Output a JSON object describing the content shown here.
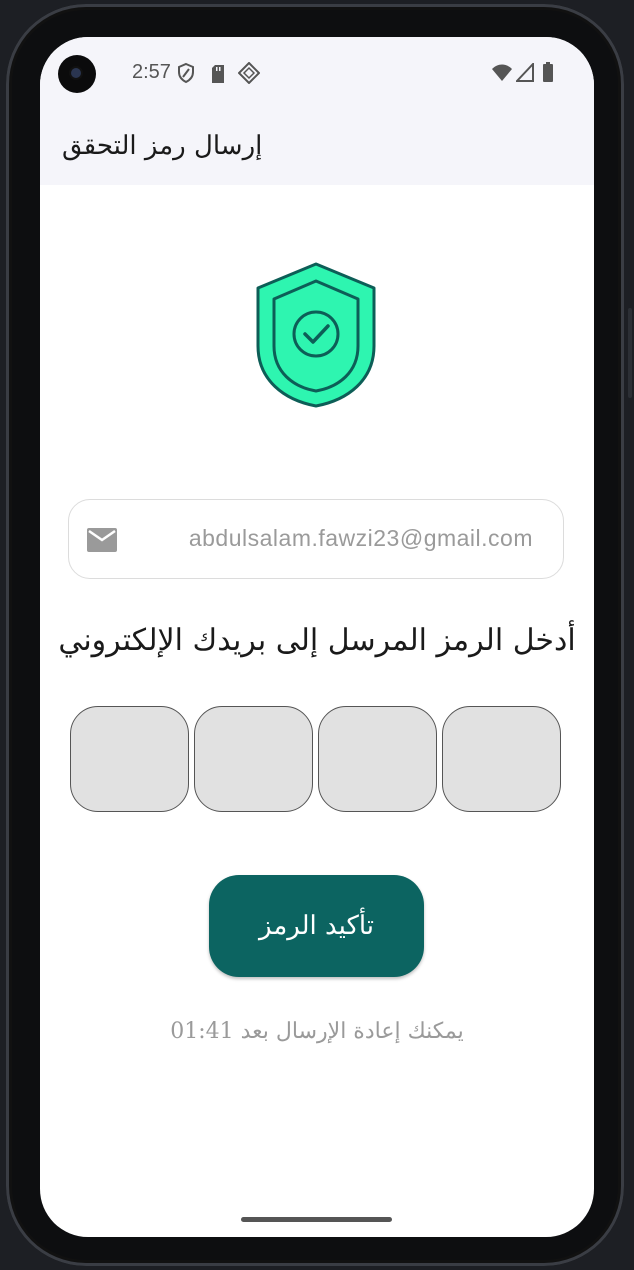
{
  "status_bar": {
    "time": "2:57",
    "left_icons": [
      "shield-status-icon",
      "sd-card-icon",
      "location-diamond-icon"
    ],
    "right_icons": [
      "wifi-icon",
      "cellular-signal-icon",
      "battery-icon"
    ]
  },
  "app_bar": {
    "title": "إرسال رمز التحقق"
  },
  "hero": {
    "icon": "shield-check-icon",
    "fill_color": "#2ef5b0",
    "stroke_color": "#0d5e57"
  },
  "email_field": {
    "icon": "mail-icon",
    "value": "abdulsalam.fawzi23@gmail.com"
  },
  "instruction": "أدخل الرمز المرسل إلى بريدك الإلكتروني",
  "otp": {
    "digits": [
      "",
      "",
      "",
      ""
    ]
  },
  "confirm_button": {
    "label": "تأكيد الرمز",
    "color": "#0c6461"
  },
  "resend_text": "يمكنك إعادة الإرسال بعد 01:41"
}
